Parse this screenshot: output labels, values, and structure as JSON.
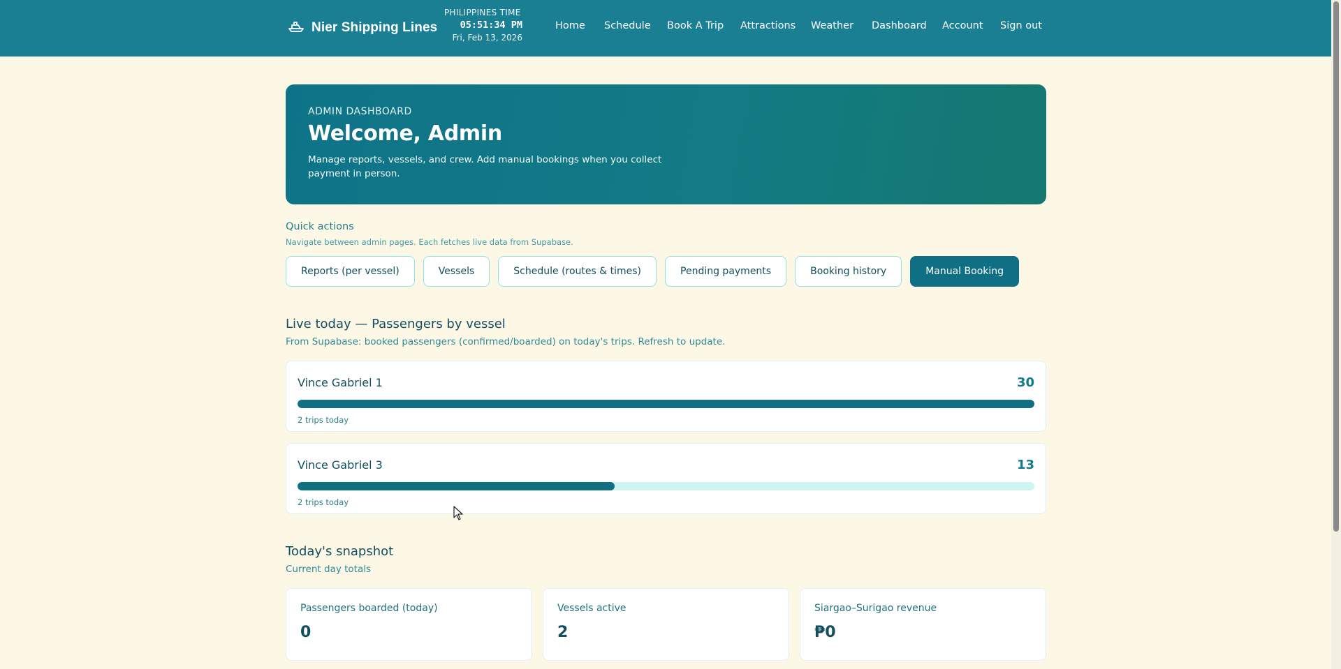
{
  "header": {
    "brand": "Nier Shipping Lines",
    "clock_label": "PHILIPPINES TIME",
    "clock_time": "05:51:34 PM",
    "clock_date": "Fri, Feb 13, 2026",
    "nav": [
      "Home",
      "Schedule",
      "Book A Trip",
      "Attractions",
      "Weather",
      "Dashboard",
      "Account",
      "Sign out"
    ],
    "brand_icon": "ship-icon",
    "bar_color": "#1a7f93"
  },
  "hero": {
    "eyebrow": "ADMIN DASHBOARD",
    "title": "Welcome, Admin",
    "description": "Manage reports, vessels, and crew. Add manual bookings when you collect payment in person."
  },
  "quick_actions": {
    "title": "Quick actions",
    "subtitle": "Navigate between admin pages. Each fetches live data from Supabase.",
    "buttons": [
      "Reports (per vessel)",
      "Vessels",
      "Schedule (routes & times)",
      "Pending payments",
      "Booking history",
      "Manual Booking"
    ],
    "primary_color": "#0f6f84"
  },
  "live": {
    "title": "Live today — Passengers by vessel",
    "subtitle": "From Supabase: booked passengers (confirmed/boarded) on today's trips. Refresh to update.",
    "vessels": [
      {
        "name": "Vince Gabriel 1",
        "count": "30",
        "trips": "2 trips today",
        "progress_pct": 100
      },
      {
        "name": "Vince Gabriel 3",
        "count": "13",
        "trips": "2 trips today",
        "progress_pct": 43
      }
    ]
  },
  "snapshot": {
    "title": "Today's snapshot",
    "subtitle": "Current day totals",
    "cards": [
      {
        "label": "Passengers boarded (today)",
        "value": "0"
      },
      {
        "label": "Vessels active",
        "value": "2"
      },
      {
        "label": "Siargao–Surigao revenue",
        "value": "₱0"
      }
    ]
  }
}
